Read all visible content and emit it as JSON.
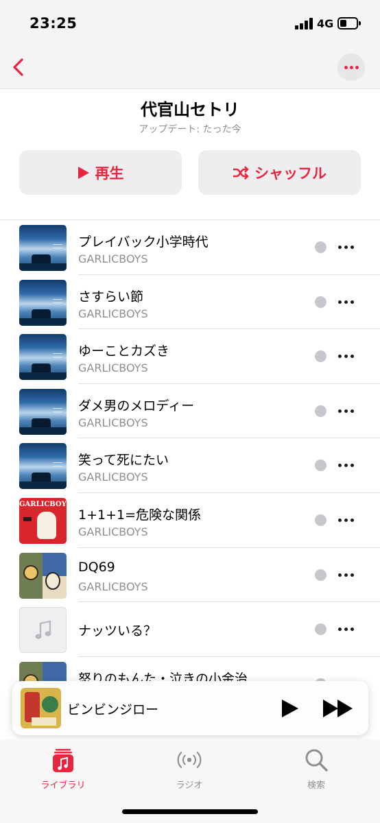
{
  "status_bar": {
    "time": "23:25",
    "network": "4G"
  },
  "header": {
    "title": "代官山セトリ",
    "updated": "アップデート: たった今"
  },
  "actions": {
    "play_label": "再生",
    "shuffle_label": "シャッフル"
  },
  "tracks": [
    {
      "title": "プレイバック小学時代",
      "artist": "GARLICBOYS",
      "art": "sky"
    },
    {
      "title": "さすらい節",
      "artist": "GARLICBOYS",
      "art": "sky"
    },
    {
      "title": "ゆーことカズき",
      "artist": "GARLICBOYS",
      "art": "sky"
    },
    {
      "title": "ダメ男のメロディー",
      "artist": "GARLICBOYS",
      "art": "sky"
    },
    {
      "title": "笑って死にたい",
      "artist": "GARLICBOYS",
      "art": "sky"
    },
    {
      "title": "1+1+1=危険な関係",
      "artist": "GARLICBOYS",
      "art": "red"
    },
    {
      "title": "DQ69",
      "artist": "GARLICBOYS",
      "art": "comic"
    },
    {
      "title": "ナッツいる？",
      "artist": "",
      "art": "empty"
    },
    {
      "title": "怒りのもんた・泣きの小金治",
      "artist": "",
      "art": "comic"
    }
  ],
  "art_text": {
    "red_label": "GARLICBOYS"
  },
  "now_playing": {
    "title": "ビンビンジロー"
  },
  "tabs": [
    {
      "label": "ライブラリ",
      "icon": "library-icon",
      "active": true
    },
    {
      "label": "ラジオ",
      "icon": "radio-icon",
      "active": false
    },
    {
      "label": "検索",
      "icon": "search-icon",
      "active": false
    }
  ],
  "colors": {
    "accent": "#e8243e",
    "secondary_text": "#8e8e93",
    "button_bg": "#eeeef0"
  }
}
